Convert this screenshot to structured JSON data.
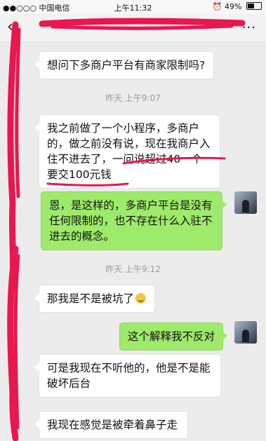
{
  "status_bar": {
    "carrier": "●●○○○ 中国电信",
    "wifi_icon": "wifi-icon",
    "time": "上午11:32",
    "battery": "49%",
    "alarm_icon": "alarm-icon"
  },
  "nav": {
    "back_icon": "chevron-left-icon",
    "more_label": "···"
  },
  "messages": [
    {
      "side": "in",
      "text": "想问下多商户平台有商家限制吗?"
    },
    {
      "side": "in",
      "text": "我之前做了一个小程序，多商户的，做之前没有说，现在我商户入住不进去了，一问说超过40一个要交100元钱"
    },
    {
      "side": "out",
      "text": "恩，是这样的，多商户平台是没有任何限制的，也不存在什么入驻不进去的概念。"
    },
    {
      "side": "in",
      "text": "那我是不是被坑了"
    },
    {
      "side": "out",
      "text": "这个解释我不反对"
    },
    {
      "side": "in",
      "text": "可是我现在不听他的，他是不是能破坏后台"
    },
    {
      "side": "in",
      "text": "我现在感觉是被牵着鼻子走"
    }
  ],
  "timestamps": [
    "昨天 上午9:07",
    "昨天 上午9:12"
  ],
  "colors": {
    "outgoing_bubble": "#9eea6a",
    "incoming_bubble": "#ffffff",
    "background": "#ececec",
    "redaction": "#e8174e"
  }
}
